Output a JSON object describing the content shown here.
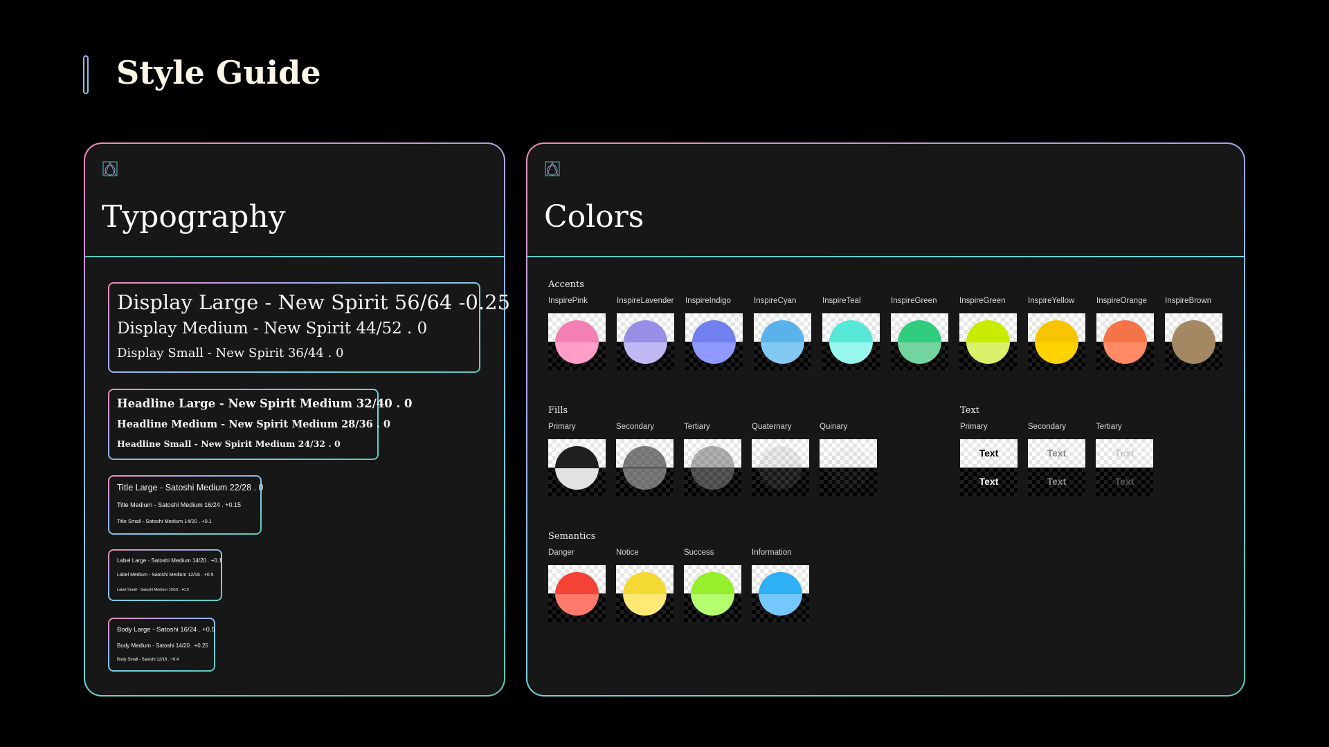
{
  "page_title": "Style Guide",
  "typography": {
    "title": "Typography",
    "groups": [
      [
        "Display Large - New Spirit 56/64 -0.25",
        "Display Medium - New Spirit 44/52 .  0",
        "Display Small - New Spirit 36/44 . 0"
      ],
      [
        "Headline Large - New Spirit Medium 32/40 . 0",
        "Headline Medium - New Spirit Medium 28/36 . 0",
        "Headline Small - New Spirit Medium 24/32 . 0"
      ],
      [
        "Title Large - Satoshi Medium 22/28 . 0",
        "Title Medium - Satoshi Medium 16/24 . +0.15",
        "Title Small - Satoshi Medium 14/20 . +0.1"
      ],
      [
        "Label Large - Satoshi Medium 14/20 . +0.1",
        "Label Medium - Satoshi Medium 12/16 . +0.5",
        "Label Small - Satoshi Medium 10/16 . +0.5"
      ],
      [
        "Body Large - Satoshi 16/24 . +0.5",
        "Body Medium - Satoshi 14/20 . +0.25",
        "Body Small - Satoshi 12/16 . +0.4"
      ]
    ]
  },
  "colors": {
    "title": "Colors",
    "accents": {
      "label": "Accents",
      "items": [
        {
          "name": "InspirePink",
          "top": "#f47fb2",
          "bottom": "#ff9fc8"
        },
        {
          "name": "InspireLavender",
          "top": "#978fe6",
          "bottom": "#c0b9f5"
        },
        {
          "name": "InspireIndigo",
          "top": "#717fef",
          "bottom": "#8f99ff"
        },
        {
          "name": "InspireCyan",
          "top": "#5ab2ea",
          "bottom": "#82c9f4"
        },
        {
          "name": "InspireTeal",
          "top": "#57e8d8",
          "bottom": "#97f7ec"
        },
        {
          "name": "InspireGreen",
          "top": "#32cc7e",
          "bottom": "#73d4a0"
        },
        {
          "name": "InspireGreen",
          "top": "#c8eb00",
          "bottom": "#d9f06a"
        },
        {
          "name": "InspireYellow",
          "top": "#f6c500",
          "bottom": "#ffd200"
        },
        {
          "name": "InspireOrange",
          "top": "#f47349",
          "bottom": "#ff8a65"
        },
        {
          "name": "InspireBrown",
          "top": "#a38863",
          "bottom": "#a38863"
        }
      ]
    },
    "fills": {
      "label": "Fills",
      "items": [
        {
          "name": "Primary",
          "top": "#1f1f1f",
          "bottom": "#e2e2e2"
        },
        {
          "name": "Secondary",
          "top": "rgba(40,40,40,0.6)",
          "bottom": "rgba(200,200,200,0.55)"
        },
        {
          "name": "Tertiary",
          "top": "rgba(60,60,60,0.4)",
          "bottom": "rgba(180,180,180,0.4)"
        },
        {
          "name": "Quaternary",
          "top": "rgba(120,120,120,0.15)",
          "bottom": "rgba(160,160,160,0.15)"
        },
        {
          "name": "Quinary",
          "top": "rgba(140,140,140,0.06)",
          "bottom": "rgba(160,160,160,0.06)"
        }
      ]
    },
    "text": {
      "label": "Text",
      "items": [
        {
          "name": "Primary",
          "sample": "Text",
          "top": "#000000",
          "bottom": "#ffffff"
        },
        {
          "name": "Secondary",
          "sample": "Text",
          "top": "#8a8a8a",
          "bottom": "#8a8a8a"
        },
        {
          "name": "Tertiary",
          "sample": "Text",
          "top": "#c8c8c8",
          "bottom": "#555555"
        }
      ]
    },
    "semantics": {
      "label": "Semantics",
      "items": [
        {
          "name": "Danger",
          "top": "#f44336",
          "bottom": "#ff7a6b"
        },
        {
          "name": "Notice",
          "top": "#f4d935",
          "bottom": "#ffe873"
        },
        {
          "name": "Success",
          "top": "#96ef2c",
          "bottom": "#b4ff6e"
        },
        {
          "name": "Information",
          "top": "#2fb0f4",
          "bottom": "#75c8ff"
        }
      ]
    }
  }
}
